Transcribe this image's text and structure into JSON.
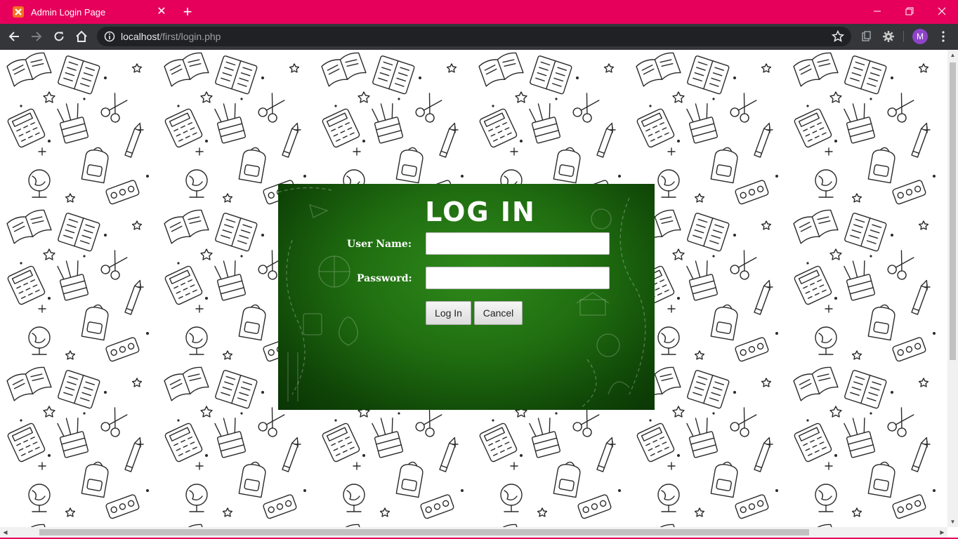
{
  "browser": {
    "tab_title": "Admin Login Page",
    "url_host": "localhost",
    "url_path": "/first/login.php",
    "profile_initial": "M",
    "theme_color": "#e6005c"
  },
  "login": {
    "title": "LOG IN",
    "username_label": "User Name:",
    "username_value": "",
    "password_label": "Password:",
    "password_value": "",
    "login_button": "Log In",
    "cancel_button": "Cancel",
    "panel_color": "#1f6c10"
  },
  "icons": {
    "favicon": "xampp-favicon",
    "tab_close": "close-icon",
    "new_tab": "plus-icon",
    "back": "back-arrow-icon",
    "forward": "forward-arrow-icon",
    "reload": "reload-icon",
    "home": "home-icon",
    "site_info": "info-icon",
    "bookmark": "star-icon",
    "extensions": [
      "clipboard-icon",
      "gear-icon"
    ],
    "menu": "more-vert-icon"
  }
}
